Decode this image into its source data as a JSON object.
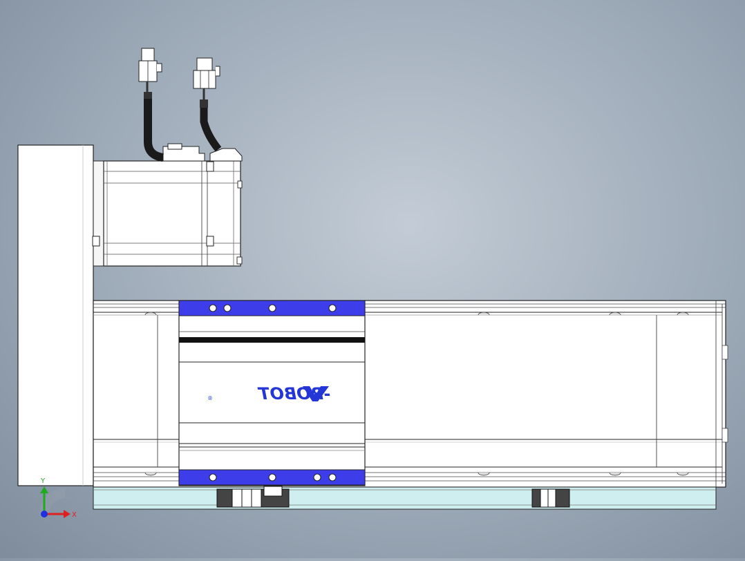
{
  "logo": {
    "text": "-ROBOT",
    "registered_mark": "®",
    "color": "#2436d6"
  },
  "axis_triad": {
    "y_label": "Y",
    "x_label": "X",
    "y_color": "#1faa1f",
    "x_color": "#e02020",
    "z_color": "#2030e0"
  },
  "colors": {
    "background": "#9aa7b5",
    "body_fill": "#ffffff",
    "outline": "#222222",
    "slider_plate": "#3d3dea",
    "base_rail": "#cfeef0",
    "cable": "#1a1a1a"
  }
}
